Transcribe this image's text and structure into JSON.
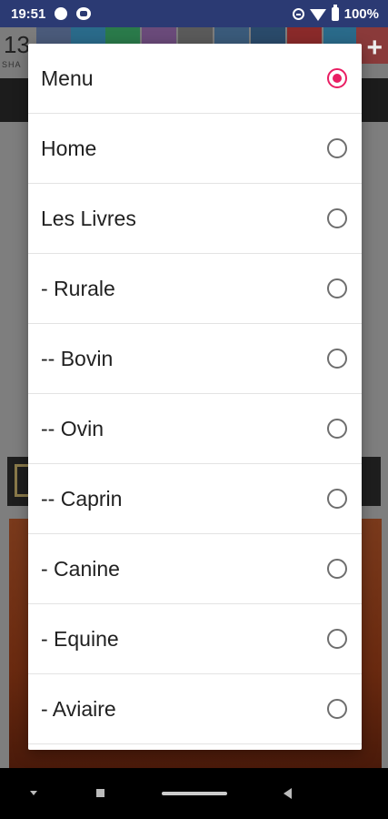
{
  "status_bar": {
    "time": "19:51",
    "battery": "100%",
    "icons": [
      "circle-notification-icon",
      "app-notification-icon",
      "dnd-icon",
      "wifi-icon",
      "battery-icon"
    ]
  },
  "background": {
    "share_count": "13",
    "share_label": "SHA",
    "plus_label": "+"
  },
  "dialog": {
    "selected_index": 0,
    "accent_color": "#e91e63",
    "options": [
      {
        "label": "Menu",
        "selected": true
      },
      {
        "label": "Home",
        "selected": false
      },
      {
        "label": "Les Livres",
        "selected": false
      },
      {
        "label": "- Rurale",
        "selected": false
      },
      {
        "label": "-- Bovin",
        "selected": false
      },
      {
        "label": "-- Ovin",
        "selected": false
      },
      {
        "label": "-- Caprin",
        "selected": false
      },
      {
        "label": "- Canine",
        "selected": false
      },
      {
        "label": "- Equine",
        "selected": false
      },
      {
        "label": "- Aviaire",
        "selected": false
      }
    ]
  },
  "nav_bar": {
    "icons": [
      "keyboard-down-icon",
      "recents-icon",
      "home-pill-icon",
      "back-icon"
    ]
  }
}
